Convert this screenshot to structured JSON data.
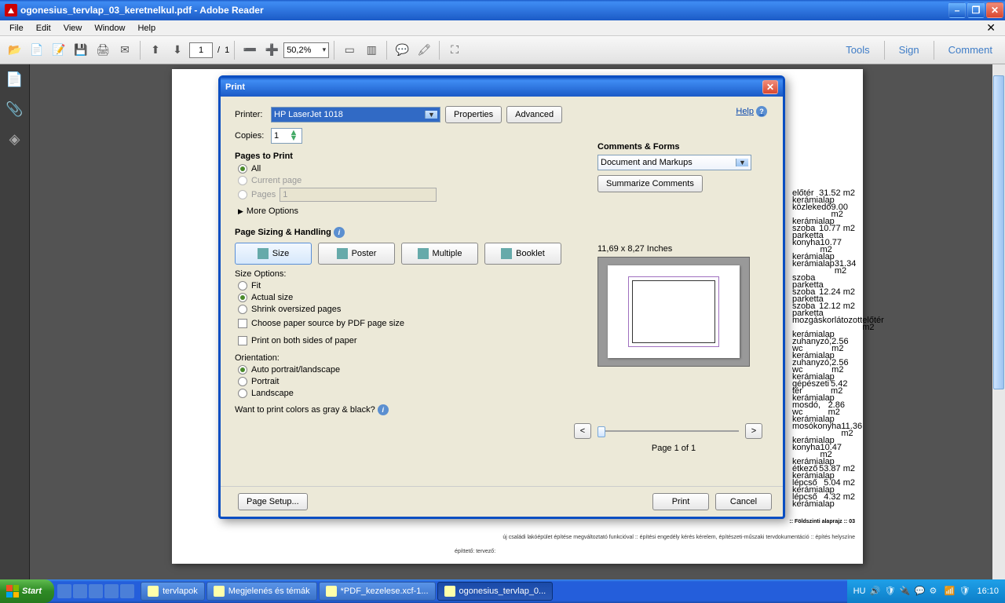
{
  "window": {
    "title": "ogonesius_tervlap_03_keretnelkul.pdf - Adobe Reader",
    "menus": [
      "File",
      "Edit",
      "View",
      "Window",
      "Help"
    ]
  },
  "toolbar": {
    "page_current": "1",
    "page_sep": "/",
    "page_total": "1",
    "zoom": "50,2%",
    "links": {
      "tools": "Tools",
      "sign": "Sign",
      "comment": "Comment"
    }
  },
  "print": {
    "title": "Print",
    "printer_lbl": "Printer:",
    "printer_name": "HP LaserJet 1018",
    "properties": "Properties",
    "advanced": "Advanced",
    "help": "Help",
    "copies_lbl": "Copies:",
    "copies_val": "1",
    "pages_to_print": "Pages to Print",
    "opt_all": "All",
    "opt_current": "Current page",
    "opt_pages": "Pages",
    "pages_val": "1",
    "more_options": "More Options",
    "sizing_handling": "Page Sizing & Handling",
    "btn_size": "Size",
    "btn_poster": "Poster",
    "btn_multiple": "Multiple",
    "btn_booklet": "Booklet",
    "size_options": "Size Options:",
    "opt_fit": "Fit",
    "opt_actual": "Actual size",
    "opt_shrink": "Shrink oversized pages",
    "chk_papersrc": "Choose paper source by PDF page size",
    "chk_bothsides": "Print on both sides of paper",
    "orientation": "Orientation:",
    "opt_auto": "Auto portrait/landscape",
    "opt_portrait": "Portrait",
    "opt_landscape": "Landscape",
    "gray_q": "Want to print colors as gray & black?",
    "comments_forms": "Comments & Forms",
    "comments_sel": "Document and Markups",
    "summarize": "Summarize Comments",
    "paper_dims": "11,69 x 8,27 Inches",
    "nav_prev": "<",
    "nav_next": ">",
    "page_of": "Page 1 of 1",
    "page_setup": "Page Setup...",
    "btn_print": "Print",
    "btn_cancel": "Cancel"
  },
  "pdf": {
    "rows": [
      [
        "előtér",
        "31.52 m2"
      ],
      [
        "kerámialap",
        ""
      ],
      [
        "közlekedő",
        "9.00 m2"
      ],
      [
        "kerámialap",
        ""
      ],
      [
        "szoba",
        "10.77 m2"
      ],
      [
        "parketta",
        ""
      ],
      [
        "konyha",
        "10.77 m2"
      ],
      [
        "kerámialap",
        ""
      ],
      [
        "kerámialap",
        "31.34 m2"
      ],
      [
        "szoba",
        ""
      ],
      [
        "parketta",
        ""
      ],
      [
        "szoba",
        "12.24 m2"
      ],
      [
        "parketta",
        ""
      ],
      [
        "szoba",
        "12.12 m2"
      ],
      [
        "parketta",
        ""
      ],
      [
        "mozgáskorlátozott",
        "előtér m2"
      ],
      [
        "kerámialap",
        ""
      ],
      [
        "zuhanyzó, wc",
        "2.56 m2"
      ],
      [
        "kerámialap",
        ""
      ],
      [
        "zuhanyzó, wc",
        "2.56 m2"
      ],
      [
        "kerámialap",
        ""
      ],
      [
        "gépészeti tér",
        "5.42 m2"
      ],
      [
        "kerámialap",
        ""
      ],
      [
        "mosdó, wc",
        "2.86 m2"
      ],
      [
        "kerámialap",
        ""
      ],
      [
        "mosókonyha",
        "11.36 m2"
      ],
      [
        "kerámialap",
        ""
      ],
      [
        "konyha",
        "10.47 m2"
      ],
      [
        "kerámialap",
        ""
      ],
      [
        "étkező",
        "53.87 m2"
      ],
      [
        "kerámialap",
        ""
      ],
      [
        "lépcső",
        "5.04 m2"
      ],
      [
        "kerámialap",
        ""
      ],
      [
        "lépcső",
        "4.32 m2"
      ],
      [
        "kerámialap",
        ""
      ]
    ],
    "bottom_right": ":: Földszinti alaprajz :: 03",
    "footer": "új családi lakóépület építése megváltoztató funkcióval :: építési engedély kérés kérelem, építészeti-műszaki tervdokumentáció :: építés helyszíne",
    "footer2": "építtető:                                                                                                                                 tervező:"
  },
  "taskbar": {
    "start": "Start",
    "tasks": [
      "tervlapok",
      "Megjelenés és témák",
      "*PDF_kezelese.xcf-1...",
      "ogonesius_tervlap_0..."
    ],
    "lang": "HU",
    "time": "16:10"
  }
}
